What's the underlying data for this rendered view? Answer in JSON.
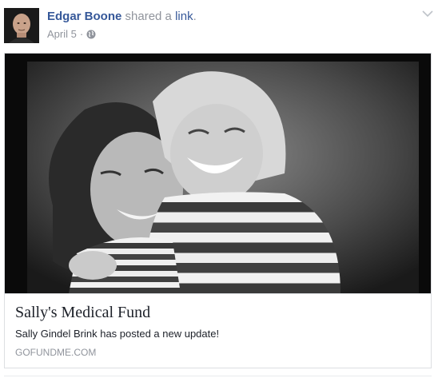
{
  "post": {
    "author": "Edgar Boone",
    "action_prefix": "shared a",
    "action_link": "link",
    "action_suffix": ".",
    "date": "April 5",
    "separator": "·",
    "privacy_icon": "globe-icon",
    "menu_icon": "chevron-down-icon"
  },
  "link_card": {
    "title": "Sally's Medical Fund",
    "description": "Sally Gindel Brink has posted a new update!",
    "domain": "GOFUNDME.COM"
  },
  "colors": {
    "author_link": "#365899",
    "meta_text": "#90949c",
    "card_border": "#dddfe2",
    "title_text": "#1d2129"
  }
}
